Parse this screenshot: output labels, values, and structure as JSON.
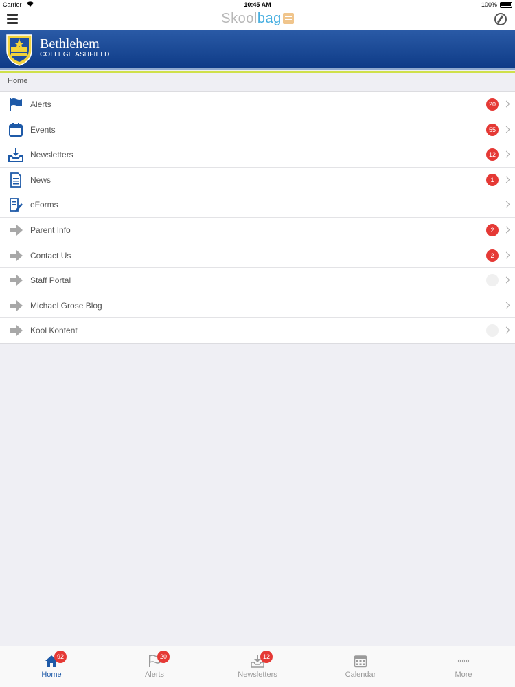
{
  "status_bar": {
    "carrier": "Carrier",
    "time": "10:45 AM",
    "battery": "100%"
  },
  "nav": {
    "brand_part1": "Skool",
    "brand_part2": "bag"
  },
  "school": {
    "name": "Bethlehem",
    "subtitle": "COLLEGE ASHFIELD"
  },
  "breadcrumb": "Home",
  "menu": [
    {
      "label": "Alerts",
      "badge": "20",
      "icon": "flag-icon"
    },
    {
      "label": "Events",
      "badge": "55",
      "icon": "calendar-icon"
    },
    {
      "label": "Newsletters",
      "badge": "12",
      "icon": "inbox-download-icon"
    },
    {
      "label": "News",
      "badge": "1",
      "icon": "document-icon"
    },
    {
      "label": "eForms",
      "badge": "",
      "icon": "form-edit-icon"
    },
    {
      "label": "Parent Info",
      "badge": "2",
      "icon": "arrow-right-icon"
    },
    {
      "label": "Contact Us",
      "badge": "2",
      "icon": "arrow-right-icon"
    },
    {
      "label": "Staff Portal",
      "badge": "",
      "icon": "arrow-right-icon"
    },
    {
      "label": "Michael Grose Blog",
      "badge": "",
      "icon": "arrow-right-icon"
    },
    {
      "label": "Kool Kontent",
      "badge": "",
      "icon": "arrow-right-icon"
    }
  ],
  "tabs": [
    {
      "label": "Home",
      "badge": "92",
      "icon": "home-icon",
      "active": true
    },
    {
      "label": "Alerts",
      "badge": "20",
      "icon": "flag-icon"
    },
    {
      "label": "Newsletters",
      "badge": "12",
      "icon": "inbox-download-icon"
    },
    {
      "label": "Calendar",
      "badge": "",
      "icon": "calendar-icon"
    },
    {
      "label": "More",
      "badge": "",
      "icon": "more-dots-icon"
    }
  ],
  "colors": {
    "accent": "#1e5aa8",
    "badge": "#e53935",
    "banner": "#0e3b87"
  }
}
